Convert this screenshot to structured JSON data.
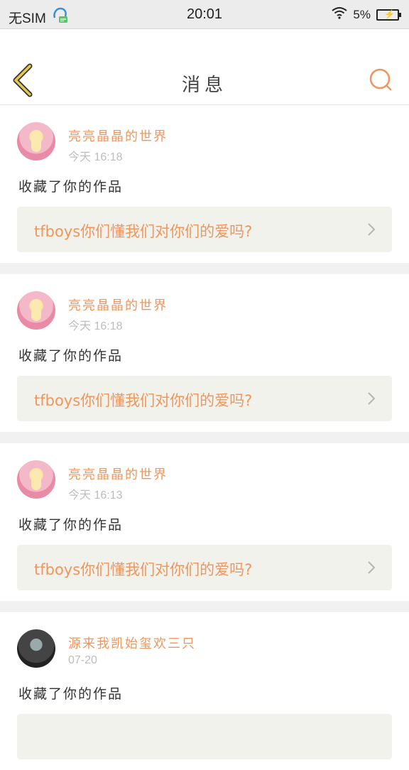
{
  "status_bar": {
    "carrier": "无SIM",
    "time": "20:01",
    "battery": "5%"
  },
  "header": {
    "title": "消息"
  },
  "messages": [
    {
      "username": "亮亮晶晶的世界",
      "time": "今天 16:18",
      "action": "收藏了你的作品",
      "work_title": "tfboys你们懂我们对你们的爱吗?",
      "avatar": "pink"
    },
    {
      "username": "亮亮晶晶的世界",
      "time": "今天 16:18",
      "action": "收藏了你的作品",
      "work_title": "tfboys你们懂我们对你们的爱吗?",
      "avatar": "pink"
    },
    {
      "username": "亮亮晶晶的世界",
      "time": "今天 16:13",
      "action": "收藏了你的作品",
      "work_title": "tfboys你们懂我们对你们的爱吗?",
      "avatar": "pink"
    },
    {
      "username": "源来我凯始玺欢三只",
      "time": "07-20",
      "action": "收藏了你的作品",
      "work_title": "",
      "avatar": "dark"
    }
  ],
  "colors": {
    "accent": "#f0955b",
    "back_icon": "#e8c84a",
    "card_bg": "#f2f2ec"
  },
  "icons": {
    "back": "chevron-left-icon",
    "search": "search-icon",
    "chevron": "chevron-right-icon",
    "battery": "battery-icon",
    "wifi": "wifi-icon",
    "notification": "notification-icon"
  }
}
